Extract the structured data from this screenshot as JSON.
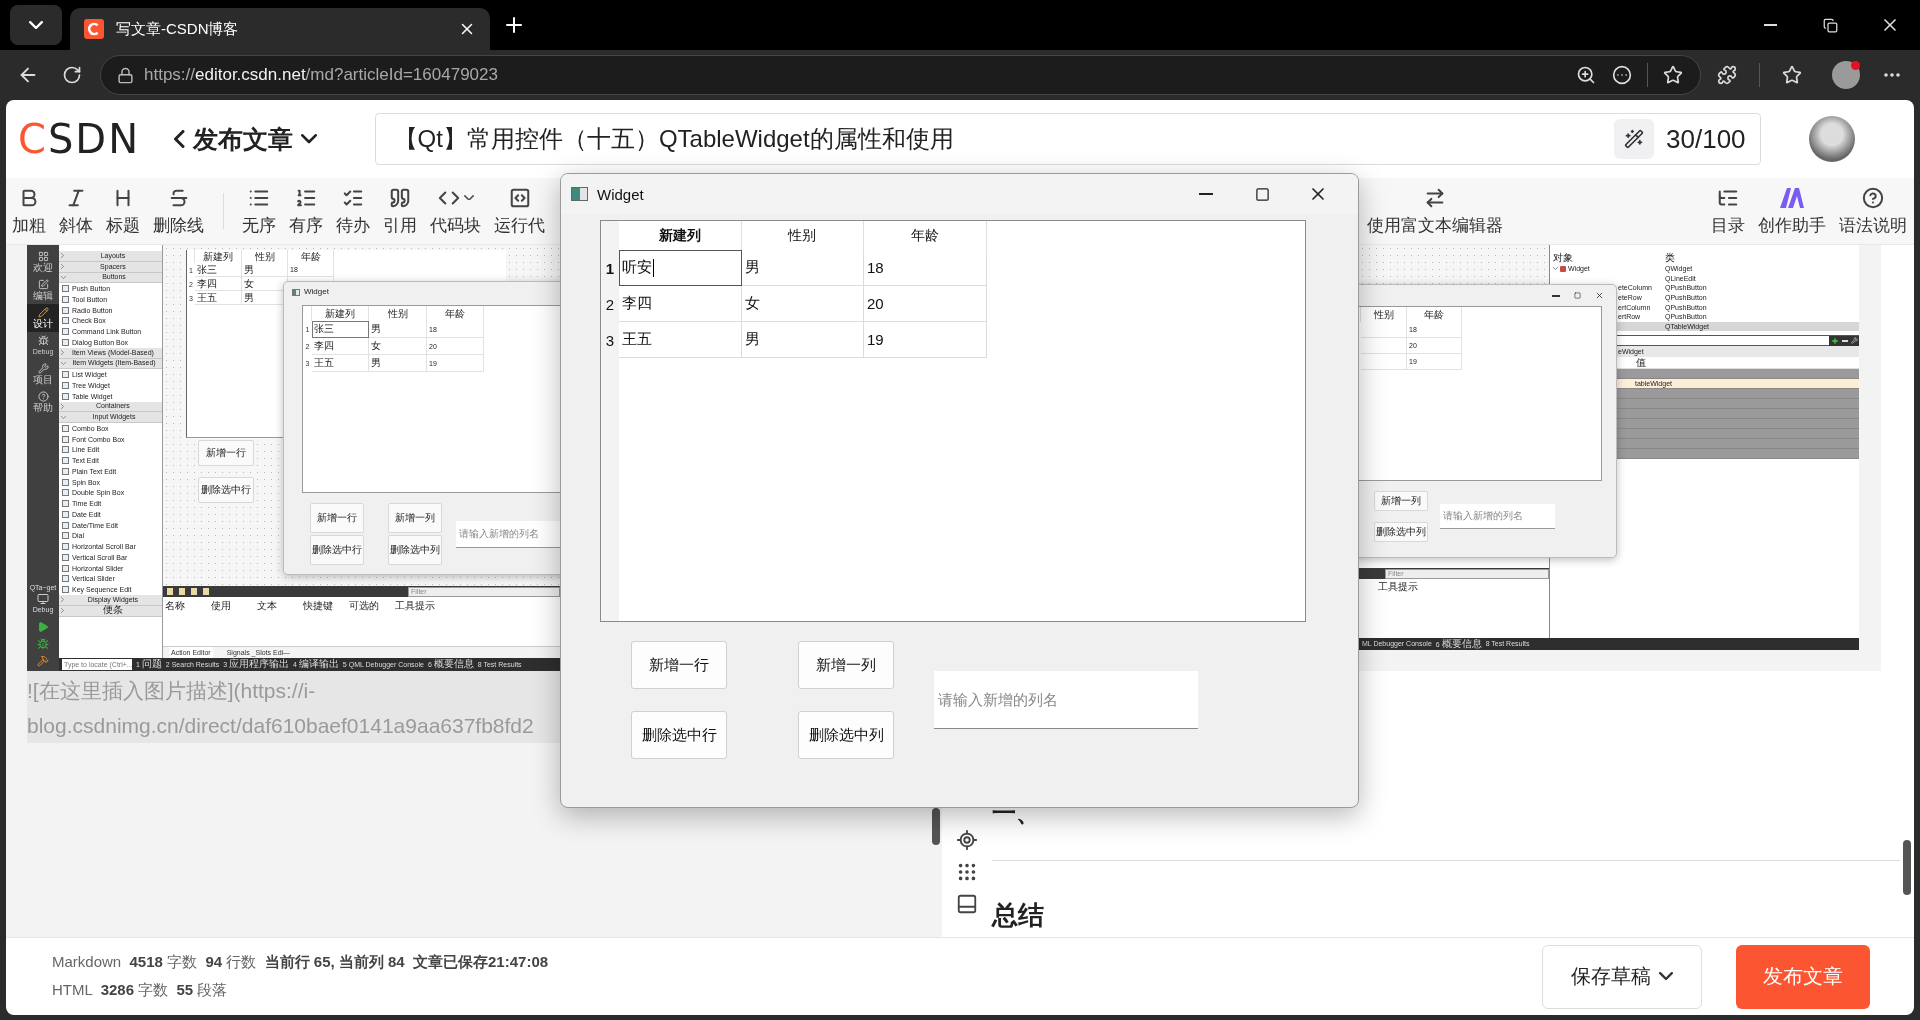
{
  "browser": {
    "tab": {
      "title": "写文章-CSDN博客",
      "selected": true
    },
    "url": {
      "scheme": "https://",
      "host": "editor.csdn.net",
      "path": "/md?articleId=160479023"
    },
    "profile_notification": true
  },
  "header": {
    "logo": "CSDN",
    "publish_menu": "发布文章",
    "title_value": "【Qt】常用控件（十五）QTableWidget的属性和使用",
    "title_count": "30/100"
  },
  "toolbar": {
    "left": [
      {
        "kind": "bold",
        "label": "加粗"
      },
      {
        "kind": "italic",
        "label": "斜体"
      },
      {
        "kind": "heading",
        "label": "标题"
      },
      {
        "kind": "strike",
        "label": "删除线"
      },
      {
        "kind": "divider"
      },
      {
        "kind": "bullets",
        "label": "无序"
      },
      {
        "kind": "numbered",
        "label": "有序"
      },
      {
        "kind": "todo",
        "label": "待办"
      },
      {
        "kind": "quote",
        "label": "引用"
      },
      {
        "kind": "code",
        "label": "代码块"
      },
      {
        "kind": "run",
        "label": "运行代"
      }
    ],
    "right": [
      {
        "kind": "richtext",
        "label": "使用富文本编辑器"
      },
      {
        "kind": "outline",
        "label": "目录"
      },
      {
        "kind": "assistant",
        "label": "创作助手"
      },
      {
        "kind": "help",
        "label": "语法说明"
      }
    ]
  },
  "left_shot": {
    "modes": [
      {
        "kind": "welcome",
        "label": "欢迎",
        "selected": false
      },
      {
        "kind": "edit",
        "label": "编辑",
        "selected": false
      },
      {
        "kind": "design",
        "label": "设计",
        "selected": true
      },
      {
        "kind": "debug",
        "label": "Debug",
        "selected": false
      },
      {
        "kind": "project",
        "label": "项目",
        "selected": false
      },
      {
        "kind": "help",
        "label": "帮助",
        "selected": false
      }
    ],
    "target": {
      "name": "QTa~get",
      "mode": "Debug"
    },
    "widget_box": [
      {
        "label": "Layouts",
        "expanded": false
      },
      {
        "label": "Spacers",
        "expanded": false
      },
      {
        "label": "Buttons",
        "expanded": true,
        "items": [
          "Push Button",
          "Tool Button",
          "Radio Button",
          "Check Box",
          "Command Link Button",
          "Dialog Button Box"
        ]
      },
      {
        "label": "Item Views (Model-Based)",
        "expanded": false
      },
      {
        "label": "Item Widgets (Item-Based)",
        "expanded": true,
        "items": [
          "List Widget",
          "Tree Widget",
          "Table Widget"
        ]
      },
      {
        "label": "Containers",
        "expanded": false
      },
      {
        "label": "Input Widgets",
        "expanded": true,
        "items": [
          "Combo Box",
          "Font Combo Box",
          "Line Edit",
          "Text Edit",
          "Plain Text Edit",
          "Spin Box",
          "Double Spin Box",
          "Time Edit",
          "Date Edit",
          "Date/Time Edit",
          "Dial",
          "Horizontal Scroll Bar",
          "Vertical Scroll Bar",
          "Horizontal Slider",
          "Vertical Slider",
          "Key Sequence Edit"
        ]
      },
      {
        "label": "Display Widgets",
        "expanded": false
      },
      {
        "label": "便条",
        "expanded": false
      }
    ],
    "form_table": {
      "columns": [
        "新建列",
        "性别",
        "年龄"
      ],
      "rows": [
        {
          "header": "1",
          "cells": [
            "张三",
            "男",
            "18"
          ]
        },
        {
          "header": "2",
          "cells": [
            "李四",
            "女"
          ]
        },
        {
          "header": "3",
          "cells": [
            "王五",
            "男"
          ]
        }
      ]
    },
    "form_buttons": [
      "新增一行",
      "删除选中行"
    ],
    "preview_window": {
      "title": "Widget",
      "columns": [
        "新建列",
        "性别",
        "年龄"
      ],
      "rows": [
        {
          "header": "1",
          "cells": [
            {
              "text": "张三",
              "editing": true
            },
            {
              "text": "男",
              "editing": false
            },
            {
              "text": "18",
              "editing": false
            }
          ]
        },
        {
          "header": "2",
          "cells": [
            {
              "text": "李四",
              "editing": false
            },
            {
              "text": "女",
              "editing": false
            },
            {
              "text": "20",
              "editing": false
            }
          ]
        },
        {
          "header": "3",
          "cells": [
            {
              "text": "王五",
              "editing": false
            },
            {
              "text": "男",
              "editing": false
            },
            {
              "text": "19",
              "editing": false
            }
          ]
        }
      ],
      "buttons": [
        "新增一行",
        "新增一列",
        "删除选中行",
        "删除选中列"
      ],
      "placeholder": "请输入新增的列名"
    },
    "action_editor": {
      "filter_placeholder": "Filter",
      "columns": [
        "名称",
        "使用",
        "文本",
        "快捷键",
        "可选的",
        "工具提示"
      ],
      "tabs": [
        {
          "label": "Action Editor",
          "selected": true
        },
        {
          "label": "Signals _Slots Edi—",
          "selected": false
        }
      ]
    },
    "status_bar": {
      "locate_placeholder": "Type to locate (Ctrl+...",
      "panes": [
        "1 问题",
        "2 Search Results",
        "3 应用程序输出",
        "4 编译输出",
        "5 QML Debugger Console",
        "6 概要信息",
        "8 Test Results"
      ]
    }
  },
  "markdown_lines": [
    "![在这里插入图片描述](https://i-",
    "blog.csdnimg.cn/direct/daf610baef0141a9aa637fb8fd2"
  ],
  "right_shot": {
    "preview_window": {
      "columns": [
        "性别",
        "年龄"
      ],
      "rows": [
        {
          "cells": [
            "18"
          ]
        },
        {
          "cells": [
            "20"
          ]
        },
        {
          "cells": [
            "19"
          ]
        }
      ],
      "buttons": [
        "新增一列",
        "删除选中列"
      ],
      "placeholder": "请输入新增的列名"
    },
    "object_inspector": {
      "columns": [
        "对象",
        "类"
      ],
      "rows": [
        {
          "kind": "root",
          "name": "Widget",
          "class": "QWidget",
          "selected": false
        },
        {
          "kind": "child",
          "class": "QLineEdit",
          "selected": false
        },
        {
          "kind": "child",
          "name": "eteColumn",
          "class": "QPushButton",
          "selected": false
        },
        {
          "kind": "child",
          "name": "eteRow",
          "class": "QPushButton",
          "selected": false
        },
        {
          "kind": "child",
          "name": "ertColumn",
          "class": "QPushButton",
          "selected": false
        },
        {
          "kind": "child",
          "name": "ertRow",
          "class": "QPushButton",
          "selected": false
        },
        {
          "kind": "child",
          "class": "QTableWidget",
          "selected": true
        }
      ]
    },
    "property_editor": {
      "object": "eWidget",
      "value_header": "值",
      "highlighted_value": "tableWidget"
    },
    "action_editor": {
      "filter_placeholder": "Filter",
      "column": "工具提示"
    },
    "status_panes": [
      "ML Debugger Console",
      "6 概要信息",
      "8 Test Results"
    ]
  },
  "preview": {
    "heading": "一、",
    "section_title": "总结"
  },
  "status": {
    "markdown": "Markdown  **4518** 字数  **94** 行数  **当前行 65, 当前列 84**  **文章已保存21:47:08**",
    "html": "HTML  **3286** 字数  **55** 段落"
  },
  "actions": {
    "save_draft": "保存草稿",
    "publish": "发布文章"
  },
  "app_window": {
    "title": "Widget",
    "columns": [
      {
        "label": "新建列",
        "current": true
      },
      {
        "label": "性别",
        "current": false
      },
      {
        "label": "年龄",
        "current": false
      }
    ],
    "rows": [
      {
        "header": "1",
        "current": true,
        "cells": [
          {
            "text": "听安",
            "editing": true
          },
          {
            "text": "男",
            "editing": false
          },
          {
            "text": "18",
            "editing": false
          }
        ]
      },
      {
        "header": "2",
        "current": false,
        "cells": [
          {
            "text": "李四",
            "editing": false
          },
          {
            "text": "女",
            "editing": false
          },
          {
            "text": "20",
            "editing": false
          }
        ]
      },
      {
        "header": "3",
        "current": false,
        "cells": [
          {
            "text": "王五",
            "editing": false
          },
          {
            "text": "男",
            "editing": false
          },
          {
            "text": "19",
            "editing": false
          }
        ]
      }
    ],
    "buttons": [
      "新增一行",
      "新增一列",
      "删除选中行",
      "删除选中列"
    ],
    "column_name": {
      "placeholder": "请输入新增的列名"
    }
  }
}
